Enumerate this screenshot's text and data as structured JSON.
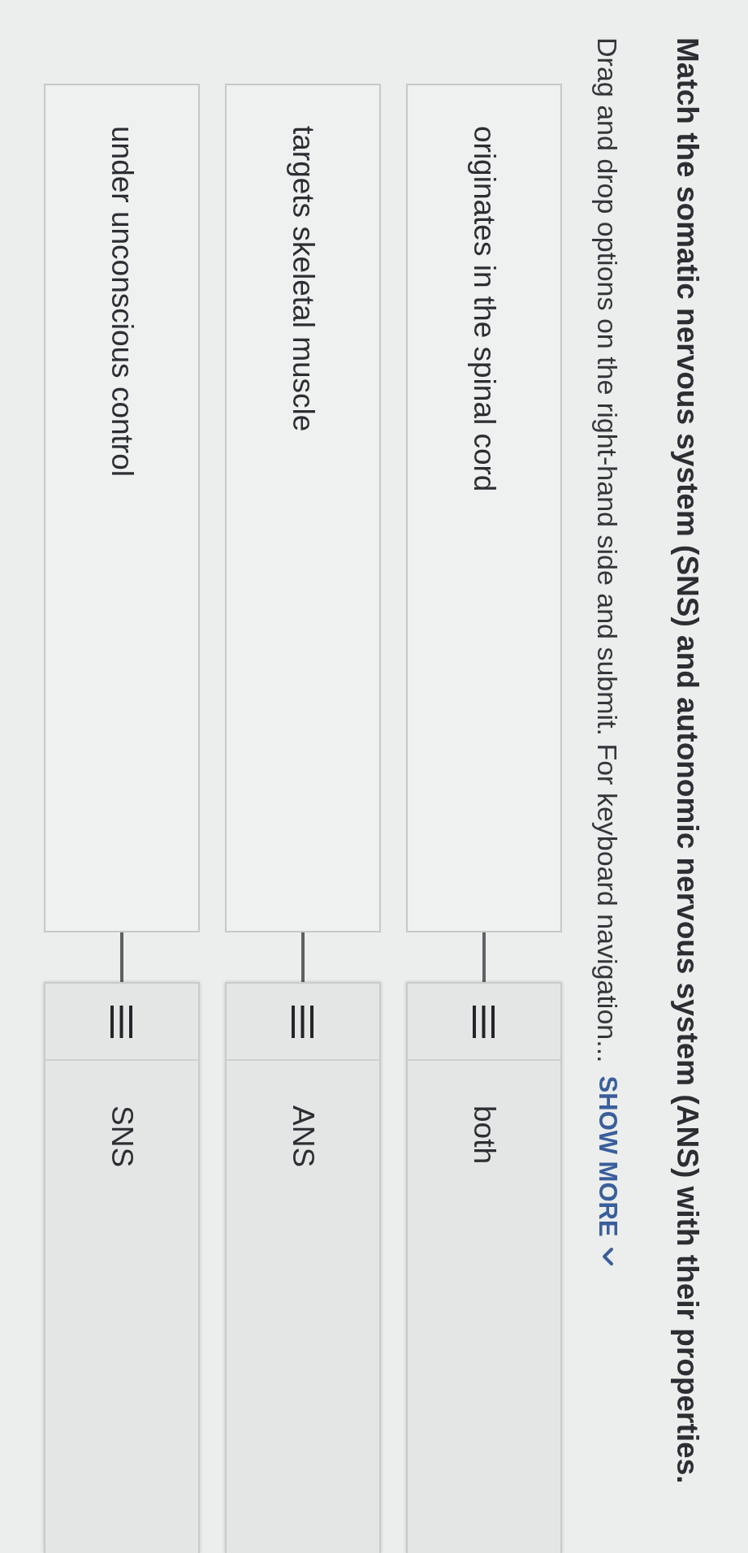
{
  "question": {
    "title": "Match the somatic nervous system (SNS) and autonomic nervous system (ANS) with their properties.",
    "instructions": "Drag and drop options on the right-hand side and submit. For keyboard navigation...",
    "show_more": {
      "label": "SHOW MORE",
      "expanded": false
    }
  },
  "pairs": [
    {
      "prompt": "originates in the spinal cord",
      "answer": "both",
      "matched": true
    },
    {
      "prompt": "targets skeletal muscle",
      "answer": "ANS",
      "matched": true
    },
    {
      "prompt": "under unconscious control",
      "answer": "SNS",
      "matched": true
    }
  ]
}
